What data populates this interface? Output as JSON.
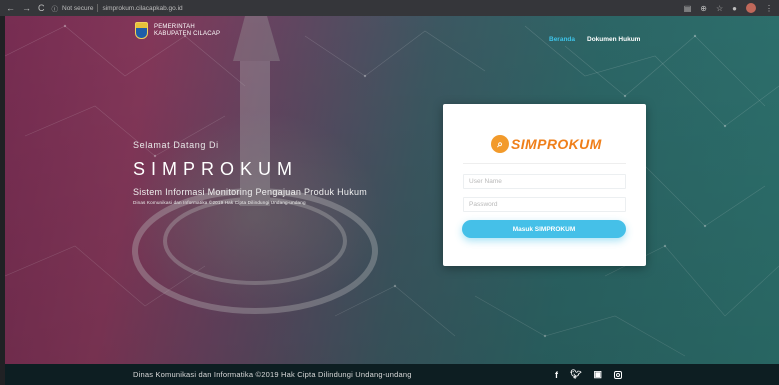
{
  "browser": {
    "back": "←",
    "forward": "→",
    "reload": "C",
    "security": "Not secure",
    "url": "simprokum.cilacapkab.go.id"
  },
  "header": {
    "brand_line1": "PEMERINTAH",
    "brand_line2": "KABUPATEN CILACAP",
    "nav": [
      {
        "label": "Beranda"
      },
      {
        "label": "Dokumen Hukum"
      }
    ]
  },
  "hero": {
    "greeting": "Selamat Datang Di",
    "title": "SIMPROKUM",
    "subtitle": "Sistem Informasi Monitoring Pengajuan Produk Hukum",
    "tagline": "Dinas Komunikasi dan Informatika ©2019 Hak Cipta Dilindungi Undang-undang"
  },
  "login": {
    "logo_text": "SIMPROKUM",
    "username_placeholder": "User Name",
    "password_placeholder": "Password",
    "submit_label": "Masuk SIMPROKUM"
  },
  "footer": {
    "copyright": "Dinas Komunikasi dan Informatika ©2019 Hak Cipta Dilindungi Undang-undang",
    "social": [
      "facebook-icon",
      "twitter-icon",
      "youtube-icon",
      "instagram-icon"
    ]
  },
  "colors": {
    "accent": "#45c0e8",
    "nav_active": "#3dc3e8",
    "logo": "#ef7f1a",
    "footer_bg": "#0d1e22"
  }
}
